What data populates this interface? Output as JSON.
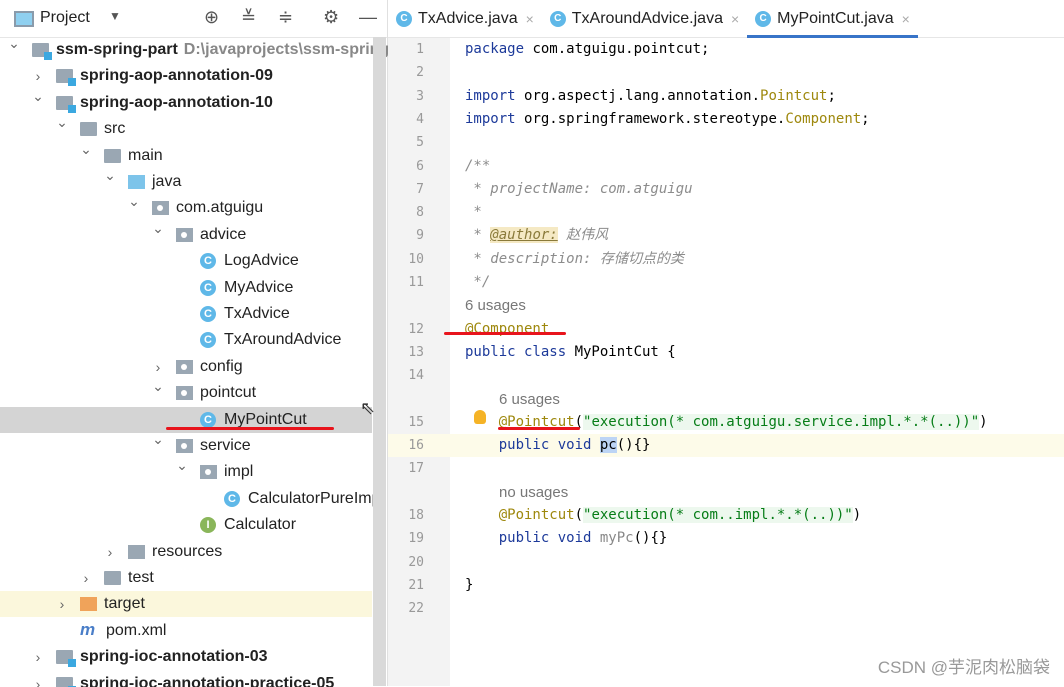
{
  "project_panel": {
    "title": "Project",
    "tools": [
      "locate-icon",
      "expand-all-icon",
      "collapse-all-icon",
      "gear-icon",
      "minimize-icon"
    ]
  },
  "tree": [
    {
      "level": 0,
      "state": "open",
      "icon": "module",
      "label": "ssm-spring-part",
      "bold": true,
      "path": "D:\\javaprojects\\ssm-spring-p"
    },
    {
      "level": 1,
      "state": "closed",
      "icon": "module",
      "label": "spring-aop-annotation-09",
      "bold": true
    },
    {
      "level": 1,
      "state": "open",
      "icon": "module",
      "label": "spring-aop-annotation-10",
      "bold": true
    },
    {
      "level": 2,
      "state": "open",
      "icon": "folder",
      "label": "src"
    },
    {
      "level": 3,
      "state": "open",
      "icon": "folder",
      "label": "main"
    },
    {
      "level": 4,
      "state": "open",
      "icon": "srcf",
      "label": "java"
    },
    {
      "level": 5,
      "state": "open",
      "icon": "pkg",
      "label": "com.atguigu"
    },
    {
      "level": 6,
      "state": "open",
      "icon": "pkg",
      "label": "advice"
    },
    {
      "level": 7,
      "state": "leaf",
      "icon": "cls",
      "label": "LogAdvice"
    },
    {
      "level": 7,
      "state": "leaf",
      "icon": "cls",
      "label": "MyAdvice"
    },
    {
      "level": 7,
      "state": "leaf",
      "icon": "cls",
      "label": "TxAdvice"
    },
    {
      "level": 7,
      "state": "leaf",
      "icon": "cls",
      "label": "TxAroundAdvice"
    },
    {
      "level": 6,
      "state": "closed",
      "icon": "pkg",
      "label": "config"
    },
    {
      "level": 6,
      "state": "open",
      "icon": "pkg",
      "label": "pointcut"
    },
    {
      "level": 7,
      "state": "leaf",
      "icon": "cls",
      "label": "MyPointCut",
      "selected": true
    },
    {
      "level": 6,
      "state": "open",
      "icon": "pkg",
      "label": "service"
    },
    {
      "level": 7,
      "state": "open",
      "icon": "pkg",
      "label": "impl"
    },
    {
      "level": 8,
      "state": "leaf",
      "icon": "cls",
      "label": "CalculatorPureImpl"
    },
    {
      "level": 7,
      "state": "leaf",
      "icon": "intf",
      "label": "Calculator"
    },
    {
      "level": 4,
      "state": "closed",
      "icon": "res",
      "label": "resources"
    },
    {
      "level": 3,
      "state": "closed",
      "icon": "folder",
      "label": "test"
    },
    {
      "level": 2,
      "state": "closed",
      "icon": "orange",
      "label": "target",
      "target": true
    },
    {
      "level": 2,
      "state": "leaf",
      "icon": "maven",
      "label": "pom.xml"
    },
    {
      "level": 1,
      "state": "closed",
      "icon": "module",
      "label": "spring-ioc-annotation-03",
      "bold": true
    },
    {
      "level": 1,
      "state": "closed",
      "icon": "module",
      "label": "spring-ioc-annotation-practice-05",
      "bold": true
    }
  ],
  "tabs": [
    {
      "label": "TxAdvice.java"
    },
    {
      "label": "TxAroundAdvice.java"
    },
    {
      "label": "MyPointCut.java",
      "active": true
    }
  ],
  "code": [
    {
      "n": "1",
      "s": [
        [
          "package ",
          "kw"
        ],
        [
          "com.atguigu.pointcut;",
          ""
        ]
      ]
    },
    {
      "n": "2",
      "s": []
    },
    {
      "n": "3",
      "s": [
        [
          "import ",
          "kw"
        ],
        [
          "org.aspectj.lang.annotation.",
          ""
        ],
        [
          "Pointcut",
          "an"
        ],
        [
          ";",
          ""
        ]
      ]
    },
    {
      "n": "4",
      "s": [
        [
          "import ",
          "kw"
        ],
        [
          "org.springframework.stereotype.",
          ""
        ],
        [
          "Component",
          "an"
        ],
        [
          ";",
          ""
        ]
      ]
    },
    {
      "n": "5",
      "s": []
    },
    {
      "n": "6",
      "s": [
        [
          "/**",
          "cm"
        ]
      ]
    },
    {
      "n": "7",
      "s": [
        [
          " * projectName: com.atguigu",
          "cm"
        ]
      ]
    },
    {
      "n": "8",
      "s": [
        [
          " *",
          "cm"
        ]
      ]
    },
    {
      "n": "9",
      "s": [
        [
          " * ",
          "cm"
        ],
        [
          "@author:",
          "tag"
        ],
        [
          " 赵伟风",
          "cm"
        ]
      ]
    },
    {
      "n": "10",
      "s": [
        [
          " * description: 存储切点的类",
          "cm"
        ]
      ]
    },
    {
      "n": "11",
      "s": [
        [
          " */",
          "cm"
        ]
      ]
    },
    {
      "hint": "6 usages",
      "indent": 0
    },
    {
      "n": "12",
      "s": [
        [
          "@Component",
          "an"
        ]
      ]
    },
    {
      "n": "13",
      "s": [
        [
          "public class ",
          "kw"
        ],
        [
          "MyPointCut {",
          ""
        ]
      ]
    },
    {
      "n": "14",
      "s": []
    },
    {
      "hint": "6 usages",
      "indent": 1
    },
    {
      "n": "15",
      "s": [
        [
          "    ",
          ""
        ],
        [
          "@Pointcut",
          "an"
        ],
        [
          "(",
          ""
        ],
        [
          "\"execution(* com.atguigu.service.impl.*.*(..))\"",
          "st"
        ],
        [
          ")",
          ""
        ]
      ]
    },
    {
      "n": "16",
      "cur": true,
      "s": [
        [
          "    ",
          ""
        ],
        [
          "public void ",
          "kw"
        ],
        [
          "pc",
          "sel"
        ],
        [
          "(){}",
          ""
        ]
      ]
    },
    {
      "n": "17",
      "s": []
    },
    {
      "hint": "no usages",
      "indent": 1
    },
    {
      "n": "18",
      "s": [
        [
          "    ",
          ""
        ],
        [
          "@Pointcut",
          "an"
        ],
        [
          "(",
          ""
        ],
        [
          "\"execution(* com..impl.*.*(..))\"",
          "st"
        ],
        [
          ")",
          ""
        ]
      ]
    },
    {
      "n": "19",
      "s": [
        [
          "    ",
          ""
        ],
        [
          "public void ",
          "kw"
        ],
        [
          "myPc",
          "gr"
        ],
        [
          "(){}",
          ""
        ]
      ]
    },
    {
      "n": "20",
      "s": []
    },
    {
      "n": "21",
      "s": [
        [
          "}",
          ""
        ]
      ]
    },
    {
      "n": "22",
      "s": []
    }
  ],
  "watermark": "CSDN @芋泥肉松脑袋"
}
